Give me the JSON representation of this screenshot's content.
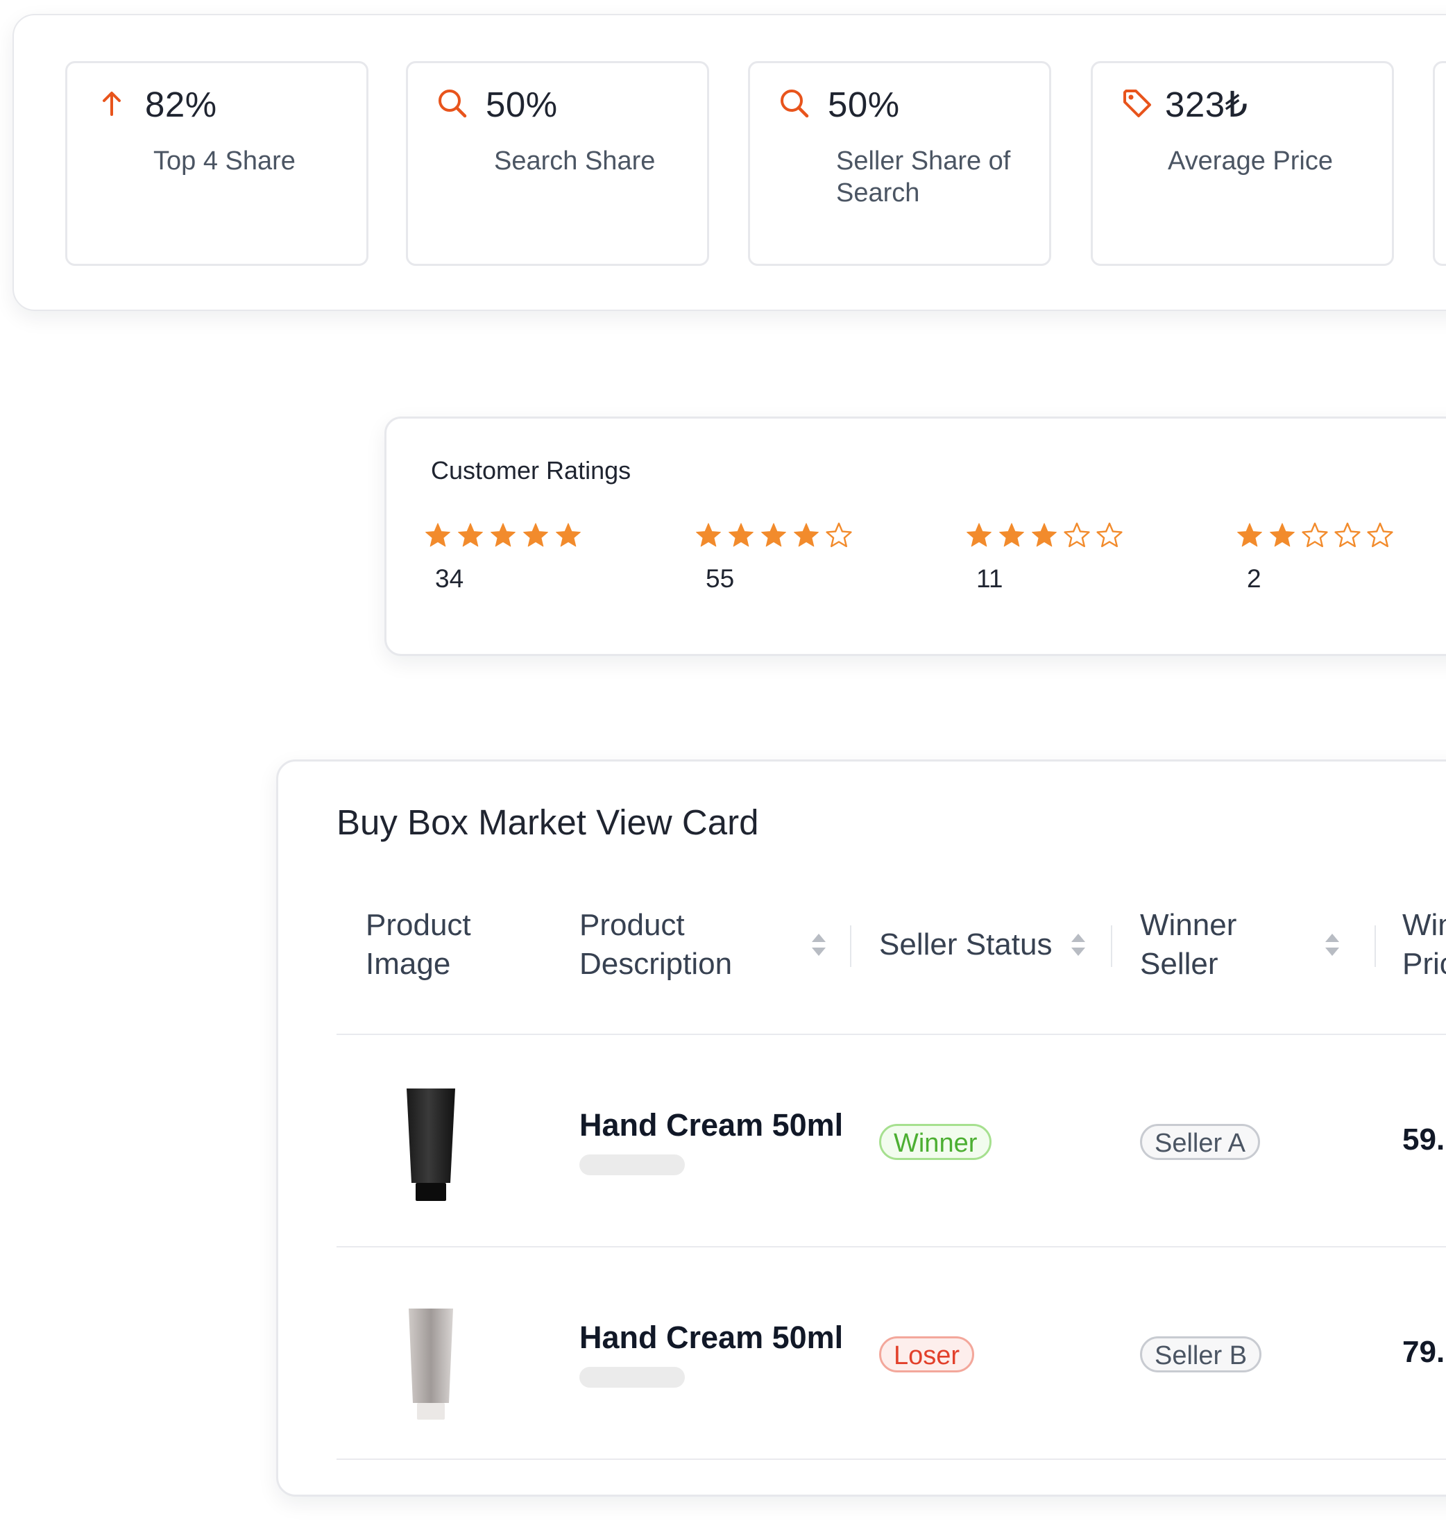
{
  "colors": {
    "accent": "#e8541c",
    "star": "#f28b2c",
    "winner": "#4caf32",
    "loser": "#e2402b"
  },
  "kpis": [
    {
      "icon": "arrow-up-icon",
      "value": "82%",
      "label": "Top 4 Share"
    },
    {
      "icon": "search-icon",
      "value": "50%",
      "label": "Search Share"
    },
    {
      "icon": "search-icon",
      "value": "50%",
      "label": "Seller Share of Search"
    },
    {
      "icon": "price-tag-icon",
      "value": "323₺",
      "label": "Average Price"
    }
  ],
  "ratings": {
    "title": "Customer Ratings",
    "groups": [
      {
        "stars": 5,
        "count": "34"
      },
      {
        "stars": 4,
        "count": "55"
      },
      {
        "stars": 3,
        "count": "11"
      },
      {
        "stars": 2,
        "count": "2"
      }
    ]
  },
  "buybox": {
    "title": "Buy Box Market View Card",
    "columns": [
      "Product Image",
      "Product Description",
      "Seller Status",
      "Winner Seller",
      "Winner Price"
    ],
    "rows": [
      {
        "product_name": "Hand Cream 50ml",
        "status": "Winner",
        "seller": "Seller A",
        "price": "59.",
        "tube": "black"
      },
      {
        "product_name": "Hand Cream 50ml",
        "status": "Loser",
        "seller": "Seller B",
        "price": "79.",
        "tube": "white"
      }
    ]
  }
}
